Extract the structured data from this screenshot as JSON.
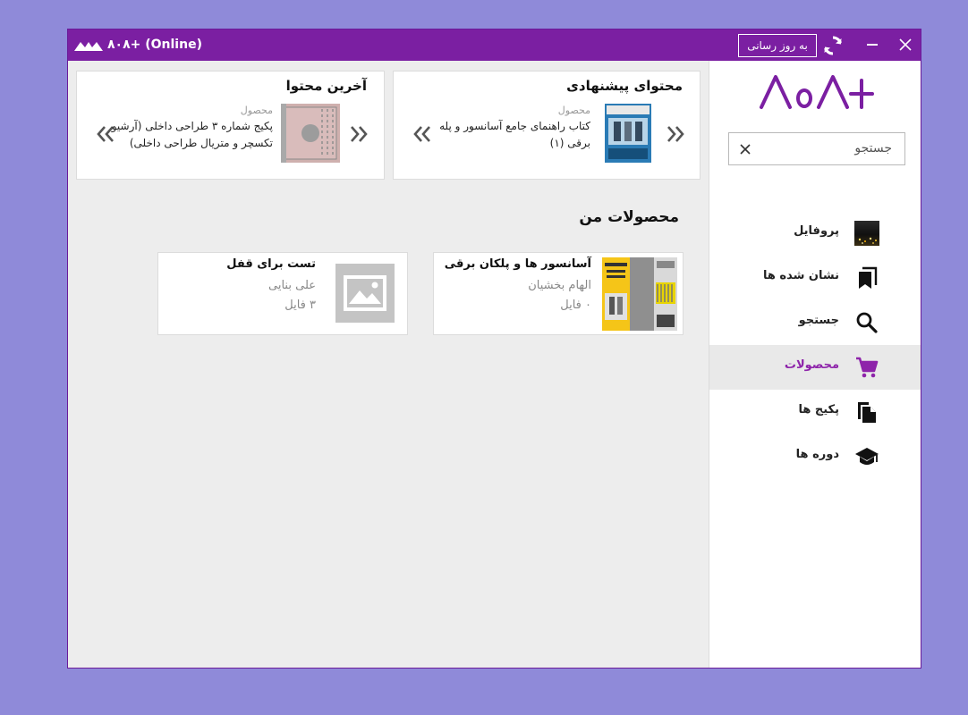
{
  "window": {
    "title": "۸۰۸+ (Online)",
    "update_button": "به روز رسانی"
  },
  "sidebar": {
    "brand": "۸۰۸+",
    "search": {
      "placeholder": "جستجو"
    },
    "items": [
      {
        "label": "پروفایل"
      },
      {
        "label": "نشان شده ها"
      },
      {
        "label": "جستجو"
      },
      {
        "label": "محصولات",
        "active": true
      },
      {
        "label": "پکیج ها"
      },
      {
        "label": "دوره ها"
      }
    ]
  },
  "recommended": {
    "title": "محتوای پیشنهادی",
    "kind": "محصول",
    "line1": "کتاب راهنمای جامع آسانسور و پله",
    "line2": "برقی (۱)"
  },
  "latest": {
    "title": "آخرین محتوا",
    "kind": "محصول",
    "line1": "پکیج شماره ۳ طراحی داخلی (آرشیو",
    "line2": "تکسچر و متریال طراحی داخلی)"
  },
  "my_products": {
    "title": "محصولات من",
    "items": [
      {
        "title": "آسانسور ها و پلکان برقی",
        "author": "الهام بخشیان",
        "files": "۰ فایل"
      },
      {
        "title": "تست برای قفل",
        "author": "علی بنایی",
        "files": "۳ فایل"
      }
    ]
  },
  "colors": {
    "accent": "#7b1fa2",
    "active_text": "#8e24aa",
    "background": "#8f8ad9"
  }
}
